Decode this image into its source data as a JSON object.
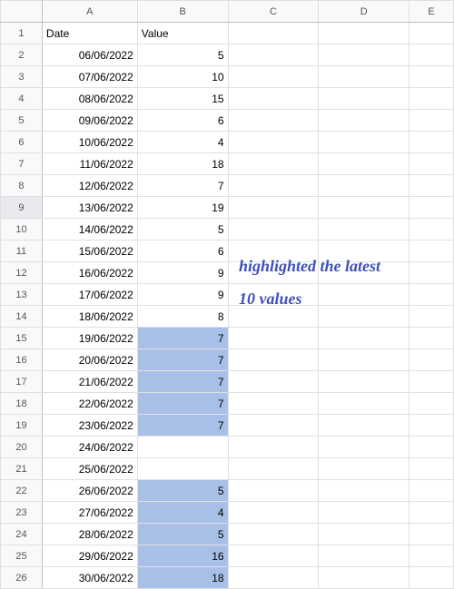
{
  "columns": [
    "A",
    "B",
    "C",
    "D",
    "E"
  ],
  "row_count": 27,
  "headers": {
    "date": "Date",
    "value": "Value"
  },
  "annotation": "highlighted the latest 10 values",
  "selected_row_header": 9,
  "rows": [
    {
      "n": 1,
      "date": "",
      "value": "",
      "hl": false,
      "is_header": true
    },
    {
      "n": 2,
      "date": "06/06/2022",
      "value": "5",
      "hl": false
    },
    {
      "n": 3,
      "date": "07/06/2022",
      "value": "10",
      "hl": false
    },
    {
      "n": 4,
      "date": "08/06/2022",
      "value": "15",
      "hl": false
    },
    {
      "n": 5,
      "date": "09/06/2022",
      "value": "6",
      "hl": false
    },
    {
      "n": 6,
      "date": "10/06/2022",
      "value": "4",
      "hl": false
    },
    {
      "n": 7,
      "date": "11/06/2022",
      "value": "18",
      "hl": false
    },
    {
      "n": 8,
      "date": "12/06/2022",
      "value": "7",
      "hl": false
    },
    {
      "n": 9,
      "date": "13/06/2022",
      "value": "19",
      "hl": false
    },
    {
      "n": 10,
      "date": "14/06/2022",
      "value": "5",
      "hl": false
    },
    {
      "n": 11,
      "date": "15/06/2022",
      "value": "6",
      "hl": false
    },
    {
      "n": 12,
      "date": "16/06/2022",
      "value": "9",
      "hl": false
    },
    {
      "n": 13,
      "date": "17/06/2022",
      "value": "9",
      "hl": false
    },
    {
      "n": 14,
      "date": "18/06/2022",
      "value": "8",
      "hl": false
    },
    {
      "n": 15,
      "date": "19/06/2022",
      "value": "7",
      "hl": true
    },
    {
      "n": 16,
      "date": "20/06/2022",
      "value": "7",
      "hl": true
    },
    {
      "n": 17,
      "date": "21/06/2022",
      "value": "7",
      "hl": true
    },
    {
      "n": 18,
      "date": "22/06/2022",
      "value": "7",
      "hl": true
    },
    {
      "n": 19,
      "date": "23/06/2022",
      "value": "7",
      "hl": true
    },
    {
      "n": 20,
      "date": "24/06/2022",
      "value": "",
      "hl": false
    },
    {
      "n": 21,
      "date": "25/06/2022",
      "value": "",
      "hl": false
    },
    {
      "n": 22,
      "date": "26/06/2022",
      "value": "5",
      "hl": true
    },
    {
      "n": 23,
      "date": "27/06/2022",
      "value": "4",
      "hl": true
    },
    {
      "n": 24,
      "date": "28/06/2022",
      "value": "5",
      "hl": true
    },
    {
      "n": 25,
      "date": "29/06/2022",
      "value": "16",
      "hl": true
    },
    {
      "n": 26,
      "date": "30/06/2022",
      "value": "18",
      "hl": true
    }
  ]
}
